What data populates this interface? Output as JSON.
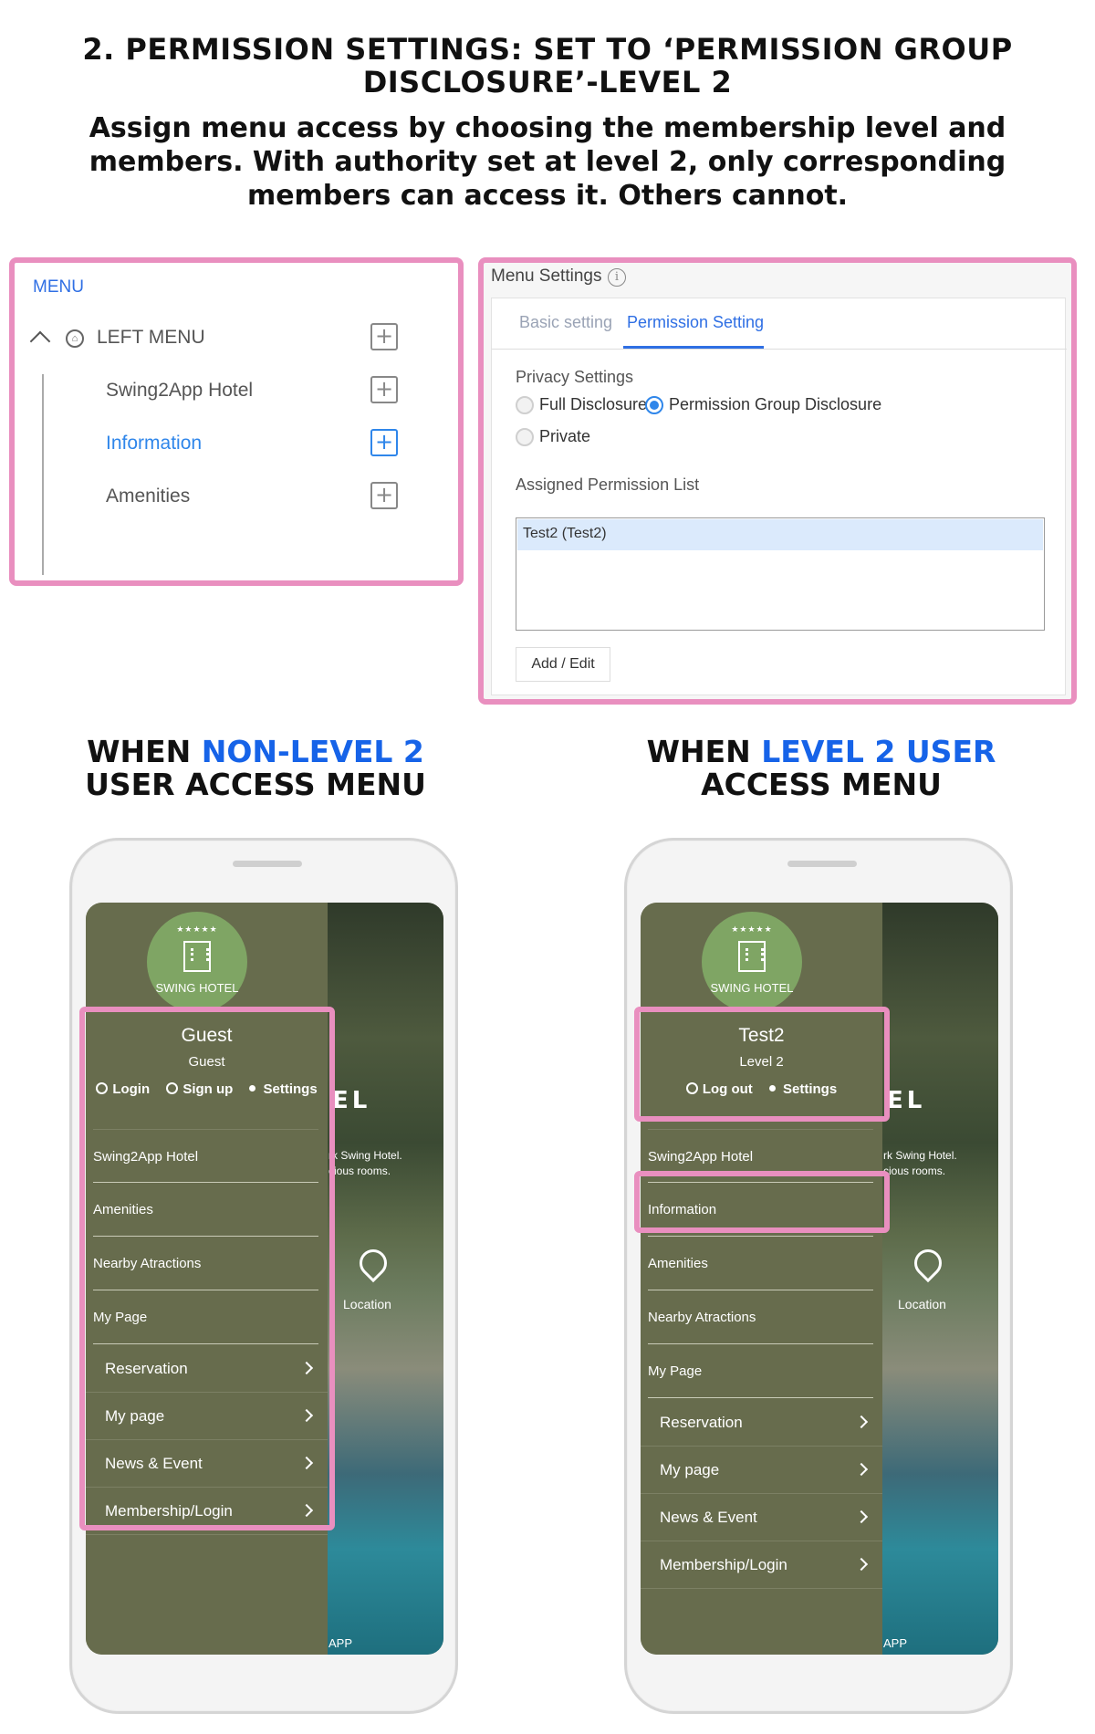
{
  "header": {
    "title_line1": "2. PERMISSION SETTINGS: SET TO ‘PERMISSION GROUP",
    "title_line2": "DISCLOSURE’-LEVEL 2",
    "sub_line1": "Assign menu access by choosing the membership level and",
    "sub_line2": "members. With authority set at level 2, only corresponding",
    "sub_line3": "members can access it. Others cannot."
  },
  "menu_tree": {
    "label": "MENU",
    "root": "LEFT MENU",
    "items": [
      {
        "label": "Swing2App Hotel"
      },
      {
        "label": "Information"
      },
      {
        "label": "Amenities"
      }
    ],
    "plus": "+"
  },
  "menu_settings": {
    "title": "Menu Settings",
    "info": "i",
    "tabs": [
      "Basic setting",
      "Permission Setting"
    ],
    "privacy_label": "Privacy Settings",
    "options": [
      "Full Disclosure",
      "Permission Group Disclosure",
      "Private"
    ],
    "selected_option": "Permission Group Disclosure",
    "assigned_label": "Assigned Permission List",
    "assigned_items": [
      "Test2 (Test2)"
    ],
    "add_button": "Add / Edit"
  },
  "captions": {
    "left": {
      "pre": "WHEN ",
      "highlight": "NON-LEVEL 2",
      "line2": "USER ACCESS MENU"
    },
    "right": {
      "pre": "WHEN ",
      "highlight": "LEVEL 2 USER",
      "line2": "ACCESS MENU"
    },
    "highlight_color": "#1663e8"
  },
  "phone_common": {
    "logo_stars": "★★★★★",
    "logo_text": "SWING HOTEL",
    "bg_big_text": "EL",
    "bg_text1": "rk Swing Hotel.",
    "bg_text2": "cious rooms.",
    "location": "Location",
    "bottom_text": "APP",
    "settings": "Settings",
    "sub_menu": [
      "Reservation",
      "My page",
      "News & Event",
      "Membership/Login"
    ]
  },
  "phone_left": {
    "user_name": "Guest",
    "user_level": "Guest",
    "action_login": "Login",
    "action_signup": "Sign up",
    "menu": [
      "Swing2App Hotel",
      "Amenities",
      "Nearby Atractions",
      "My Page"
    ]
  },
  "phone_right": {
    "user_name": "Test2",
    "user_level": "Level 2",
    "action_logout": "Log out",
    "menu": [
      "Swing2App Hotel",
      "Information",
      "Amenities",
      "Nearby Atractions",
      "My Page"
    ]
  },
  "colors": {
    "highlight_border": "#e98fbf",
    "accent_blue": "#2f6fe4",
    "drawer_bg": "#676c4d",
    "logo_bg": "#7fa564"
  }
}
